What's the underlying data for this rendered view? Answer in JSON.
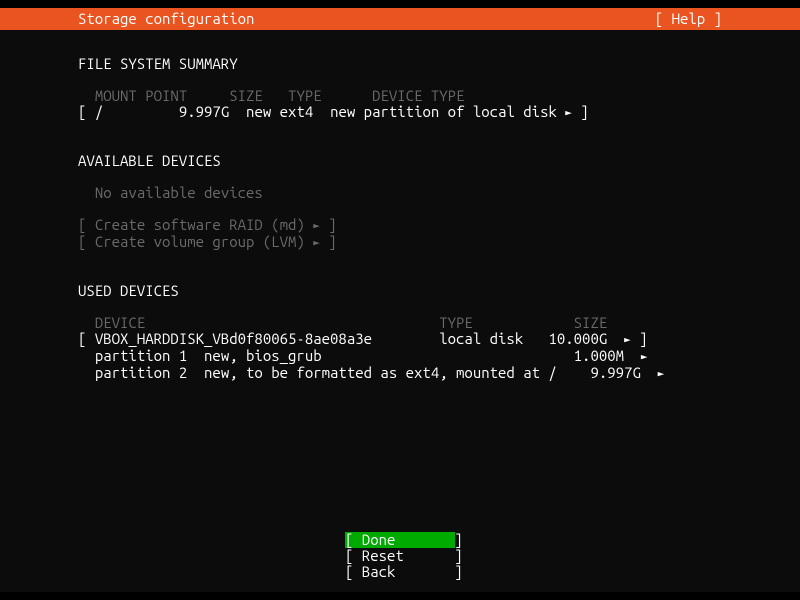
{
  "titlebar": {
    "title": "Storage configuration",
    "help": "[ Help ]"
  },
  "file_system_summary": {
    "header": "FILE SYSTEM SUMMARY",
    "columns": {
      "mount_point": "MOUNT POINT",
      "size": "SIZE",
      "type": "TYPE",
      "device_type": "DEVICE TYPE"
    },
    "rows": [
      {
        "bracket_open": "[ ",
        "mount_point": "/",
        "size": "9.997G",
        "type": "new ext4",
        "device_type": "new partition of local disk",
        "arrow": "►",
        "bracket_close": " ]"
      }
    ]
  },
  "available_devices": {
    "header": "AVAILABLE DEVICES",
    "empty_msg": "No available devices",
    "raid_label": "Create software RAID (md)",
    "lvm_label": "Create volume group (LVM)",
    "arrow": "►"
  },
  "used_devices": {
    "header": "USED DEVICES",
    "columns": {
      "device": "DEVICE",
      "type": "TYPE",
      "size": "SIZE"
    },
    "disk": {
      "name": "VBOX_HARDDISK_VBd0f80065-8ae08a3e",
      "type": "local disk",
      "size": "10.000G",
      "arrow": "►"
    },
    "partitions": [
      {
        "label": "partition 1",
        "desc": "new, bios_grub",
        "size": "1.000M",
        "arrow": "►"
      },
      {
        "label": "partition 2",
        "desc": "new, to be formatted as ext4, mounted at /",
        "size": "9.997G",
        "arrow": "►"
      }
    ]
  },
  "buttons": {
    "done": "Done",
    "reset": "Reset",
    "back": "Back"
  }
}
